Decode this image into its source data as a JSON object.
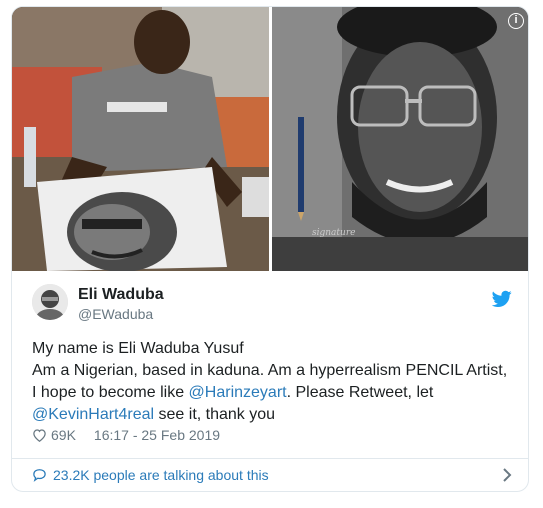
{
  "author": {
    "name": "Eli Waduba",
    "handle": "@EWaduba"
  },
  "tweet": {
    "line1": "My name is Eli Waduba Yusuf",
    "line2": "Am a Nigerian, based in kaduna. Am a hyperrealism PENCIL Artist,",
    "line3_prefix": "I hope to become like ",
    "mention1": "@Harinzeyart",
    "line3_suffix": ". Please Retweet, let",
    "mention2": "@KevinHart4real",
    "line4_suffix": " see it, thank you"
  },
  "stats": {
    "likes": "69K",
    "timestamp": "16:17 - 25 Feb 2019"
  },
  "footer": {
    "talking": "23.2K people are talking about this"
  },
  "colors": {
    "link": "#2b7bb9",
    "muted": "#697882",
    "text": "#1c2022",
    "twitter_blue": "#1da1f2"
  },
  "icons": {
    "info": "info-icon",
    "bird": "twitter-bird-icon",
    "heart": "heart-icon",
    "bubble": "speech-bubble-icon",
    "chevron": "chevron-right-icon"
  }
}
